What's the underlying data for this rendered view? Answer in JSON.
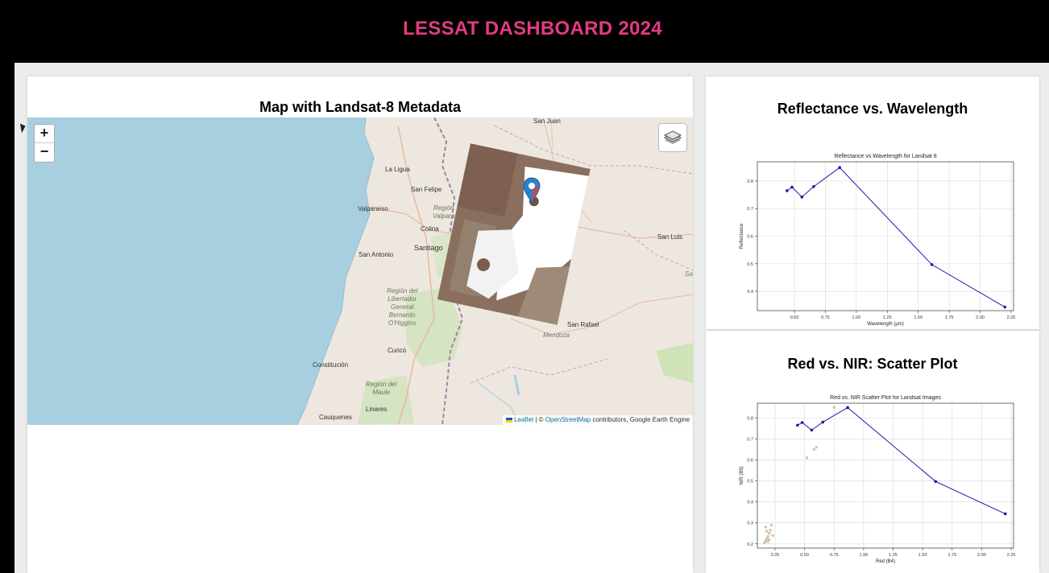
{
  "header": {
    "title": "LESSAT DASHBOARD 2024"
  },
  "map_panel": {
    "title": "Map with Landsat-8 Metadata",
    "zoom_in": "+",
    "zoom_out": "−",
    "attribution": {
      "leaflet": "Leaflet",
      "separator": " | © ",
      "osm": "OpenStreetMap",
      "rest": " contributors, Google Earth Engine"
    },
    "places": [
      "San Juan",
      "La Ligua",
      "San Felipe",
      "Valparaíso",
      "Colina",
      "Santiago",
      "San Antonio",
      "San Luis",
      "San Rafael",
      "Mendoza",
      "Curicó",
      "Constitución",
      "Linares",
      "Cauquenes",
      "Sa"
    ],
    "regions": {
      "valparaiso": [
        "Región",
        "Valpara"
      ],
      "ohiggins": [
        "Región del",
        "Libertador",
        "General",
        "Bernardo",
        "O'Higgins"
      ],
      "maule": [
        "Región del",
        "Maule"
      ]
    },
    "colors": {
      "water": "#a8cfe0",
      "land": "#ede7df",
      "marker": "#2a81cb"
    },
    "icons": {
      "layers": "layers-icon",
      "marker": "map-marker-icon"
    }
  },
  "reflectance_panel": {
    "heading": "Reflectance vs. Wavelength"
  },
  "scatter_panel": {
    "heading": "Red vs. NIR: Scatter Plot"
  },
  "chart_data": [
    {
      "type": "line",
      "title": "Reflectance vs Wavelength for Landsat 8",
      "xlabel": "Wavelength (μm)",
      "ylabel": "Reflectance",
      "xlim": [
        0.2,
        2.27
      ],
      "ylim": [
        0.33,
        0.87
      ],
      "xticks": [
        0.5,
        0.75,
        1.0,
        1.25,
        1.5,
        1.75,
        2.0,
        2.25
      ],
      "xtick_labels": [
        "0.50",
        "0.75",
        "1.00",
        "1.25",
        "1.50",
        "1.75",
        "2.00",
        "2.25"
      ],
      "yticks": [
        0.4,
        0.5,
        0.6,
        0.7,
        0.8
      ],
      "ytick_labels": [
        "0.4",
        "0.5",
        "0.6",
        "0.7",
        "0.8"
      ],
      "grid": true,
      "color": "#1a1aa6",
      "x": [
        0.44,
        0.48,
        0.56,
        0.655,
        0.865,
        1.61,
        2.2
      ],
      "y": [
        0.765,
        0.778,
        0.742,
        0.78,
        0.849,
        0.497,
        0.343
      ]
    },
    {
      "type": "scatter",
      "title": "Red vs. NIR Scatter Plot for Landsat Images",
      "xlabel": "Red (B4)",
      "ylabel": "NIR (B5)",
      "xlim": [
        0.1,
        2.27
      ],
      "ylim": [
        0.18,
        0.87
      ],
      "xticks": [
        0.25,
        0.5,
        0.75,
        1.0,
        1.25,
        1.5,
        1.75,
        2.0,
        2.25
      ],
      "xtick_labels": [
        "0.25",
        "0.50",
        "0.75",
        "1.00",
        "1.25",
        "1.50",
        "1.75",
        "2.00",
        "2.25"
      ],
      "yticks": [
        0.2,
        0.3,
        0.4,
        0.5,
        0.6,
        0.7,
        0.8
      ],
      "ytick_labels": [
        "0.2",
        "0.3",
        "0.4",
        "0.5",
        "0.6",
        "0.7",
        "0.8"
      ],
      "grid": true,
      "line_color": "#1a1aa6",
      "point_color": "#c2ad94",
      "line": {
        "x": [
          0.44,
          0.48,
          0.56,
          0.655,
          0.865,
          1.61,
          2.2
        ],
        "y": [
          0.765,
          0.778,
          0.742,
          0.78,
          0.849,
          0.497,
          0.343
        ]
      },
      "points": {
        "x": [
          0.16,
          0.17,
          0.18,
          0.19,
          0.2,
          0.21,
          0.17,
          0.18,
          0.22,
          0.23,
          0.2,
          0.19,
          0.52,
          0.58,
          0.6,
          0.75
        ],
        "y": [
          0.205,
          0.215,
          0.225,
          0.235,
          0.25,
          0.265,
          0.28,
          0.26,
          0.29,
          0.24,
          0.22,
          0.21,
          0.61,
          0.65,
          0.66,
          0.85
        ]
      }
    }
  ]
}
